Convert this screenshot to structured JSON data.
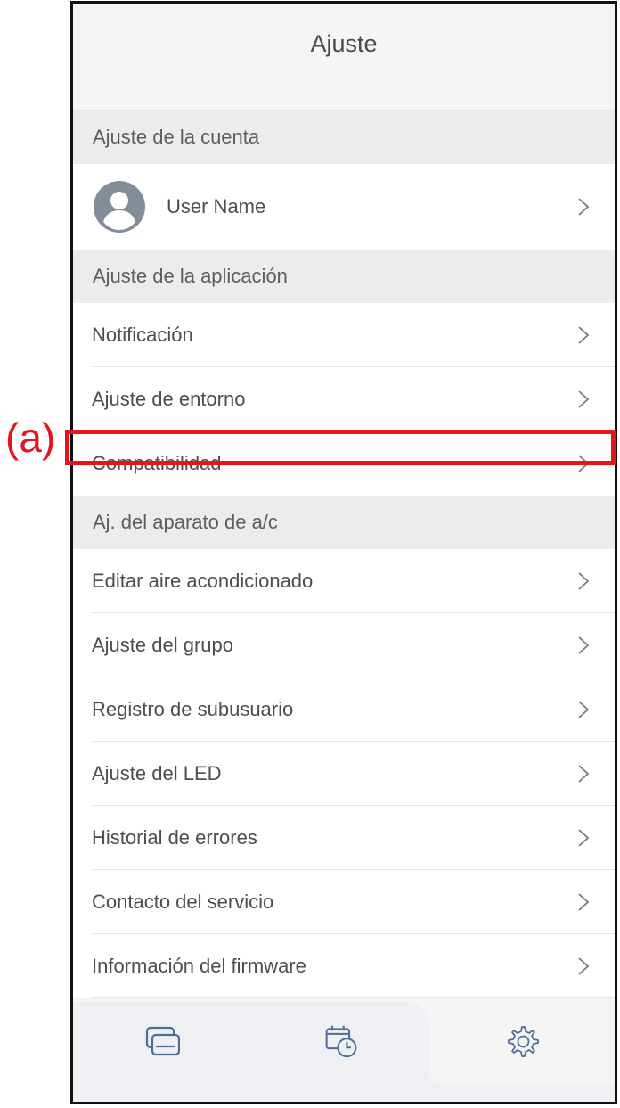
{
  "annotation": {
    "label": "(a)",
    "color": "#e8141b"
  },
  "header": {
    "title": "Ajuste"
  },
  "sections": {
    "account": {
      "label": "Ajuste de la cuenta"
    },
    "app": {
      "label": "Ajuste de la aplicación"
    },
    "ac": {
      "label": "Aj. del aparato de a/c"
    }
  },
  "user": {
    "name": "User Name",
    "avatar_icon": "user-avatar-icon"
  },
  "app_items": [
    {
      "label": "Notificación"
    },
    {
      "label": "Ajuste de entorno"
    },
    {
      "label": "Compatibilidad"
    }
  ],
  "ac_items": [
    {
      "label": "Editar aire acondicionado"
    },
    {
      "label": "Ajuste del grupo"
    },
    {
      "label": "Registro de subusuario"
    },
    {
      "label": "Ajuste del LED"
    },
    {
      "label": "Historial de errores"
    },
    {
      "label": "Contacto del servicio"
    },
    {
      "label": "Información del firmware"
    }
  ],
  "tabs": [
    {
      "icon": "devices-icon"
    },
    {
      "icon": "schedule-icon"
    },
    {
      "icon": "gear-icon",
      "selected": true
    }
  ]
}
